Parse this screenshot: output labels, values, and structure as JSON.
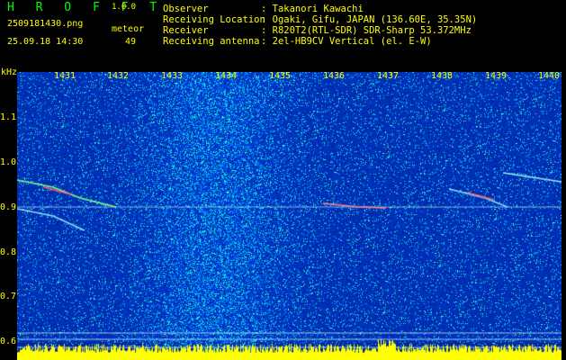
{
  "header": {
    "app_title": "H R O F F T",
    "version": "1.0.0",
    "filename": "2509181430.png",
    "datetime": "25.09.18 14:30",
    "meteor_label": "meteor",
    "meteor_count": "49"
  },
  "metadata": [
    {
      "key": "Observer",
      "value": ": Takanori Kawachi"
    },
    {
      "key": "Receiving Location",
      "value": ": Ogaki, Gifu, JAPAN (136.60E, 35.35N)"
    },
    {
      "key": "Receiver",
      "value": ": R820T2(RTL-SDR) SDR-Sharp 53.372MHz"
    },
    {
      "key": "Receiving antenna",
      "value": ": 2el-HB9CV Vertical (el. E-W)"
    }
  ],
  "axis": {
    "y_unit": "kHz",
    "y_ticks": [
      "1.1",
      "1.0",
      "0.9",
      "0.8",
      "0.7",
      "0.6"
    ],
    "x_ticks": [
      "1431",
      "1432",
      "1433",
      "1434",
      "1435",
      "1436",
      "1437",
      "1438",
      "1439",
      "1440"
    ]
  },
  "colors": {
    "text": "#ffff00",
    "title": "#00ff00",
    "background": "#000000",
    "spectrogram": "#1a2fd0",
    "noise_band": "#00c8ff",
    "echo": "#ff6070",
    "activity": "#ffff00"
  }
}
